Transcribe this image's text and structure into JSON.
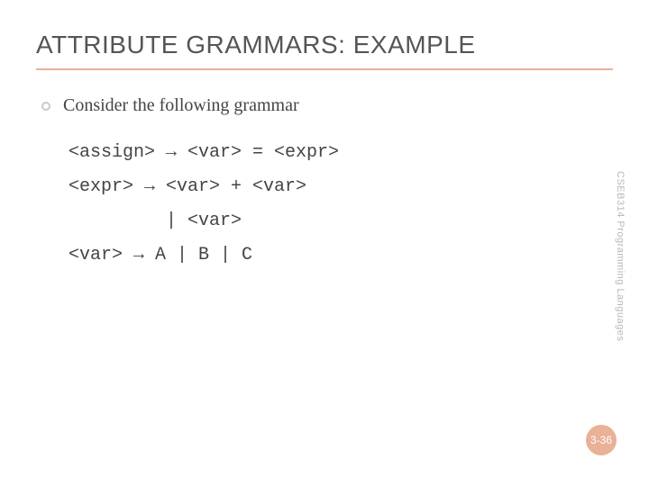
{
  "title": "ATTRIBUTE GRAMMARS: EXAMPLE",
  "bullet": "Consider the following grammar",
  "grammar": "<assign> → <var> = <expr>\n<expr> → <var> + <var>\n         | <var>\n<var> → A | B | C",
  "side_label": "CSEB314  Programming Languages",
  "page_number": "3-36"
}
